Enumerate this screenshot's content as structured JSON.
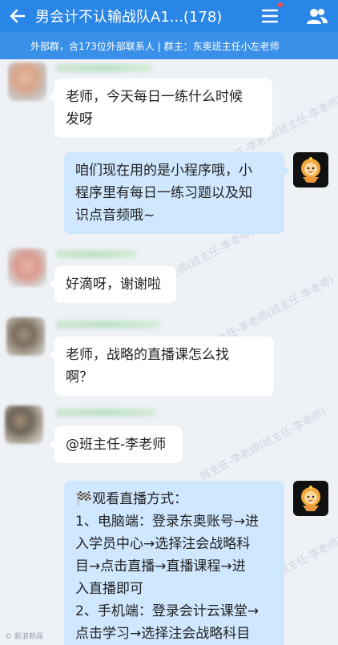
{
  "header": {
    "title": "男会计不认输战队A1...(178)"
  },
  "subheader": {
    "text": "外部群，含173位外部联系人 | 群主：东奥班主任小左老师"
  },
  "messages": [
    {
      "side": "left",
      "lines": [
        "老师，今天每日一练什么时候",
        "发呀"
      ]
    },
    {
      "side": "right",
      "lines": [
        "咱们现在用的是小程序哦，小",
        "程序里有每日一练习题以及知",
        "识点音频哦~"
      ]
    },
    {
      "side": "left",
      "lines": [
        "好滴呀，谢谢啦"
      ]
    },
    {
      "side": "left",
      "lines": [
        "老师，战略的直播课怎么找",
        "啊？"
      ]
    },
    {
      "side": "left",
      "lines": [
        "@班主任-李老师"
      ]
    },
    {
      "side": "right",
      "lines": [
        "🏁观看直播方式：",
        "1、电脑端：登录东奥账号→进",
        "入学员中心→选择注会战略科",
        "目→点击直播→直播课程→进",
        "入直播即可",
        "2、手机端：登录会计云课堂→",
        "点击学习→选择注会战略科目"
      ]
    }
  ],
  "watermark": {
    "text": "班主任-李老师(班主任-李老师)"
  },
  "footer": {
    "text": "© 新浪新闻"
  },
  "colors": {
    "header": "#2a86e6",
    "subheader": "#3a90e8",
    "background": "#eef1f6",
    "bubble_right": "#cfe7ff",
    "bubble_left": "#ffffff"
  },
  "icons": {
    "back": "arrow-left-icon",
    "menu": "menu-icon",
    "members": "people-icon",
    "teacher_avatar": "cartoon-lion-icon"
  }
}
